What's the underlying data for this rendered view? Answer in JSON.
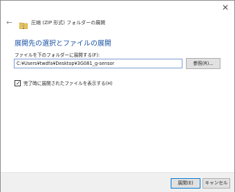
{
  "window": {
    "close_glyph": "✕",
    "title": "圧縮 (ZIP 形式) フォルダーの展開"
  },
  "nav": {
    "back_glyph": "←",
    "zip_icon": "zip-folder-icon"
  },
  "main": {
    "heading": "展開先の選択とファイルの展開",
    "destination_label": "ファイルを下のフォルダーに展開する(F):",
    "destination_value": "C:¥Users¥twdfa¥Desktop¥3G081_g-sensor",
    "browse_label": "参照(R)...",
    "show_files_label": "完了時に展開されたファイルを表示する(H)",
    "show_files_checked": true
  },
  "footer": {
    "extract_label": "展開(E)",
    "cancel_label": "キャンセル"
  },
  "colors": {
    "heading": "#1a52a5",
    "footer_bg": "#f0f0f0",
    "focus_border": "#0078d7"
  }
}
